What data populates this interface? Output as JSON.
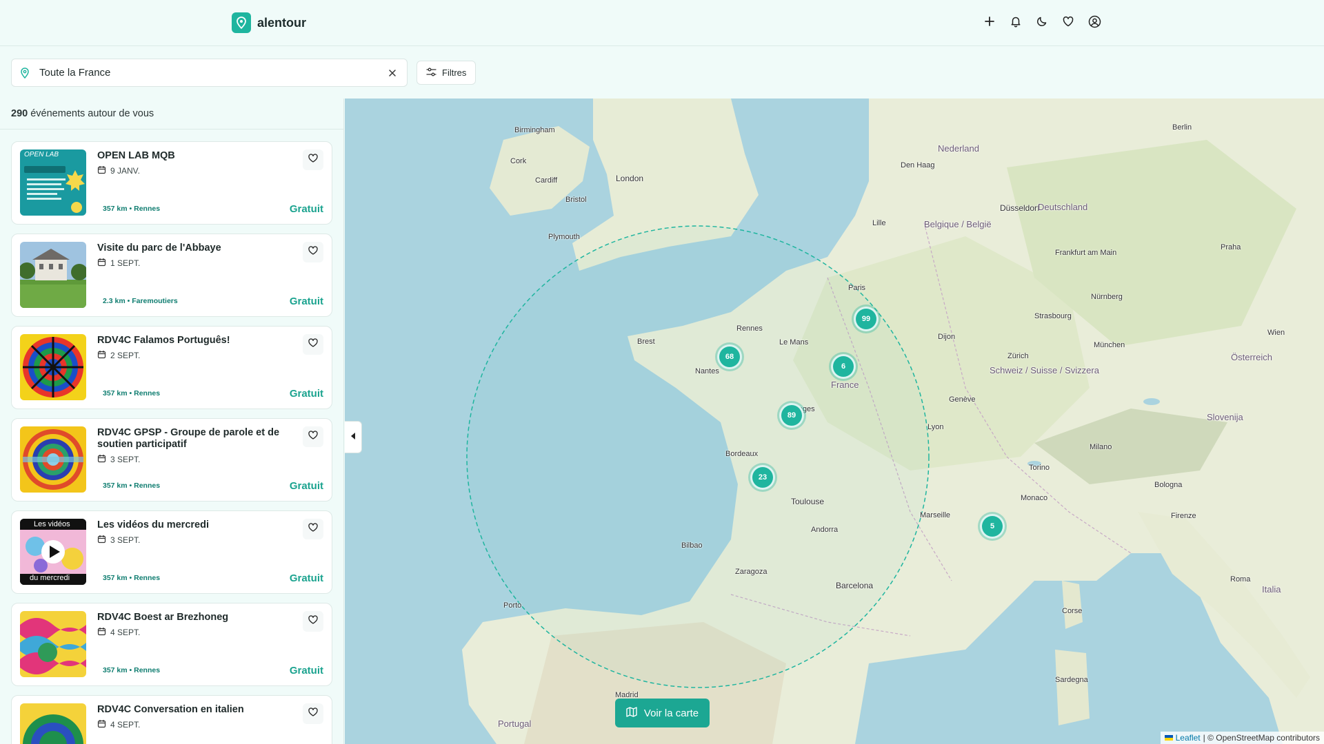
{
  "brand": {
    "name": "alentour"
  },
  "header": {
    "icons": [
      "plus-icon",
      "bell-icon",
      "moon-icon",
      "heart-icon",
      "user-circle-icon"
    ]
  },
  "search": {
    "value": "Toute la France",
    "filters_label": "Filtres"
  },
  "results": {
    "count": "290",
    "suffix": " événements autour de vous"
  },
  "events": [
    {
      "title": "OPEN LAB MQB",
      "date": "9 JANV.",
      "location": "357 km • Rennes",
      "price": "Gratuit",
      "thumb_text": "OPEN LAB"
    },
    {
      "title": "Visite du parc de l'Abbaye",
      "date": "1 SEPT.",
      "location": "2.3 km • Faremoutiers",
      "price": "Gratuit"
    },
    {
      "title": "RDV4C Falamos Português!",
      "date": "2 SEPT.",
      "location": "357 km • Rennes",
      "price": "Gratuit"
    },
    {
      "title": "RDV4C GPSP - Groupe de parole et de soutien participatif",
      "date": "3 SEPT.",
      "location": "357 km • Rennes",
      "price": "Gratuit"
    },
    {
      "title": "Les vidéos du mercredi",
      "date": "3 SEPT.",
      "location": "357 km • Rennes",
      "price": "Gratuit",
      "thumb_top": "Les vidéos",
      "thumb_bottom": "du mercredi"
    },
    {
      "title": "RDV4C Boest ar Brezhoneg",
      "date": "4 SEPT.",
      "location": "357 km • Rennes",
      "price": "Gratuit"
    },
    {
      "title": "RDV4C Conversation en italien",
      "date": "4 SEPT.",
      "location": "",
      "price": ""
    }
  ],
  "map": {
    "clusters": [
      "99",
      "68",
      "6",
      "89",
      "23",
      "5"
    ],
    "labels": [
      "Birmingham",
      "London",
      "Cardiff",
      "Plymouth",
      "Bristol",
      "Cork",
      "Den Haag",
      "Nederland",
      "Düsseldorf",
      "Belgique / België",
      "Lille",
      "Paris",
      "Rennes",
      "Le Mans",
      "France",
      "Bordeaux",
      "Toulouse",
      "Marseille",
      "Lyon",
      "Genève",
      "Zürich",
      "Schweiz / Suisse / Svizzera",
      "Deutschland",
      "Frankfurt am Main",
      "München",
      "Nürnberg",
      "Berlin",
      "Praha",
      "Wien",
      "Österreich",
      "Slovenija",
      "Andorra",
      "Barcelona",
      "Zaragoza",
      "Madrid",
      "Portugal",
      "Porto",
      "Milano",
      "Torino",
      "Bologna",
      "Firenze",
      "Roma",
      "Italia",
      "Monaco",
      "Brest",
      "Limoges",
      "Nantes",
      "Dijon",
      "Strasbourg",
      "Bilbao",
      "Sardegna",
      "Corse"
    ],
    "voir_label": "Voir la carte",
    "attribution_leaflet": "Leaflet",
    "attribution_rest": "| © OpenStreetMap contributors"
  },
  "colors": {
    "accent": "#1fb59f",
    "price": "#1ba38f",
    "background": "#f0fbf9",
    "sea": "#aad3df"
  }
}
